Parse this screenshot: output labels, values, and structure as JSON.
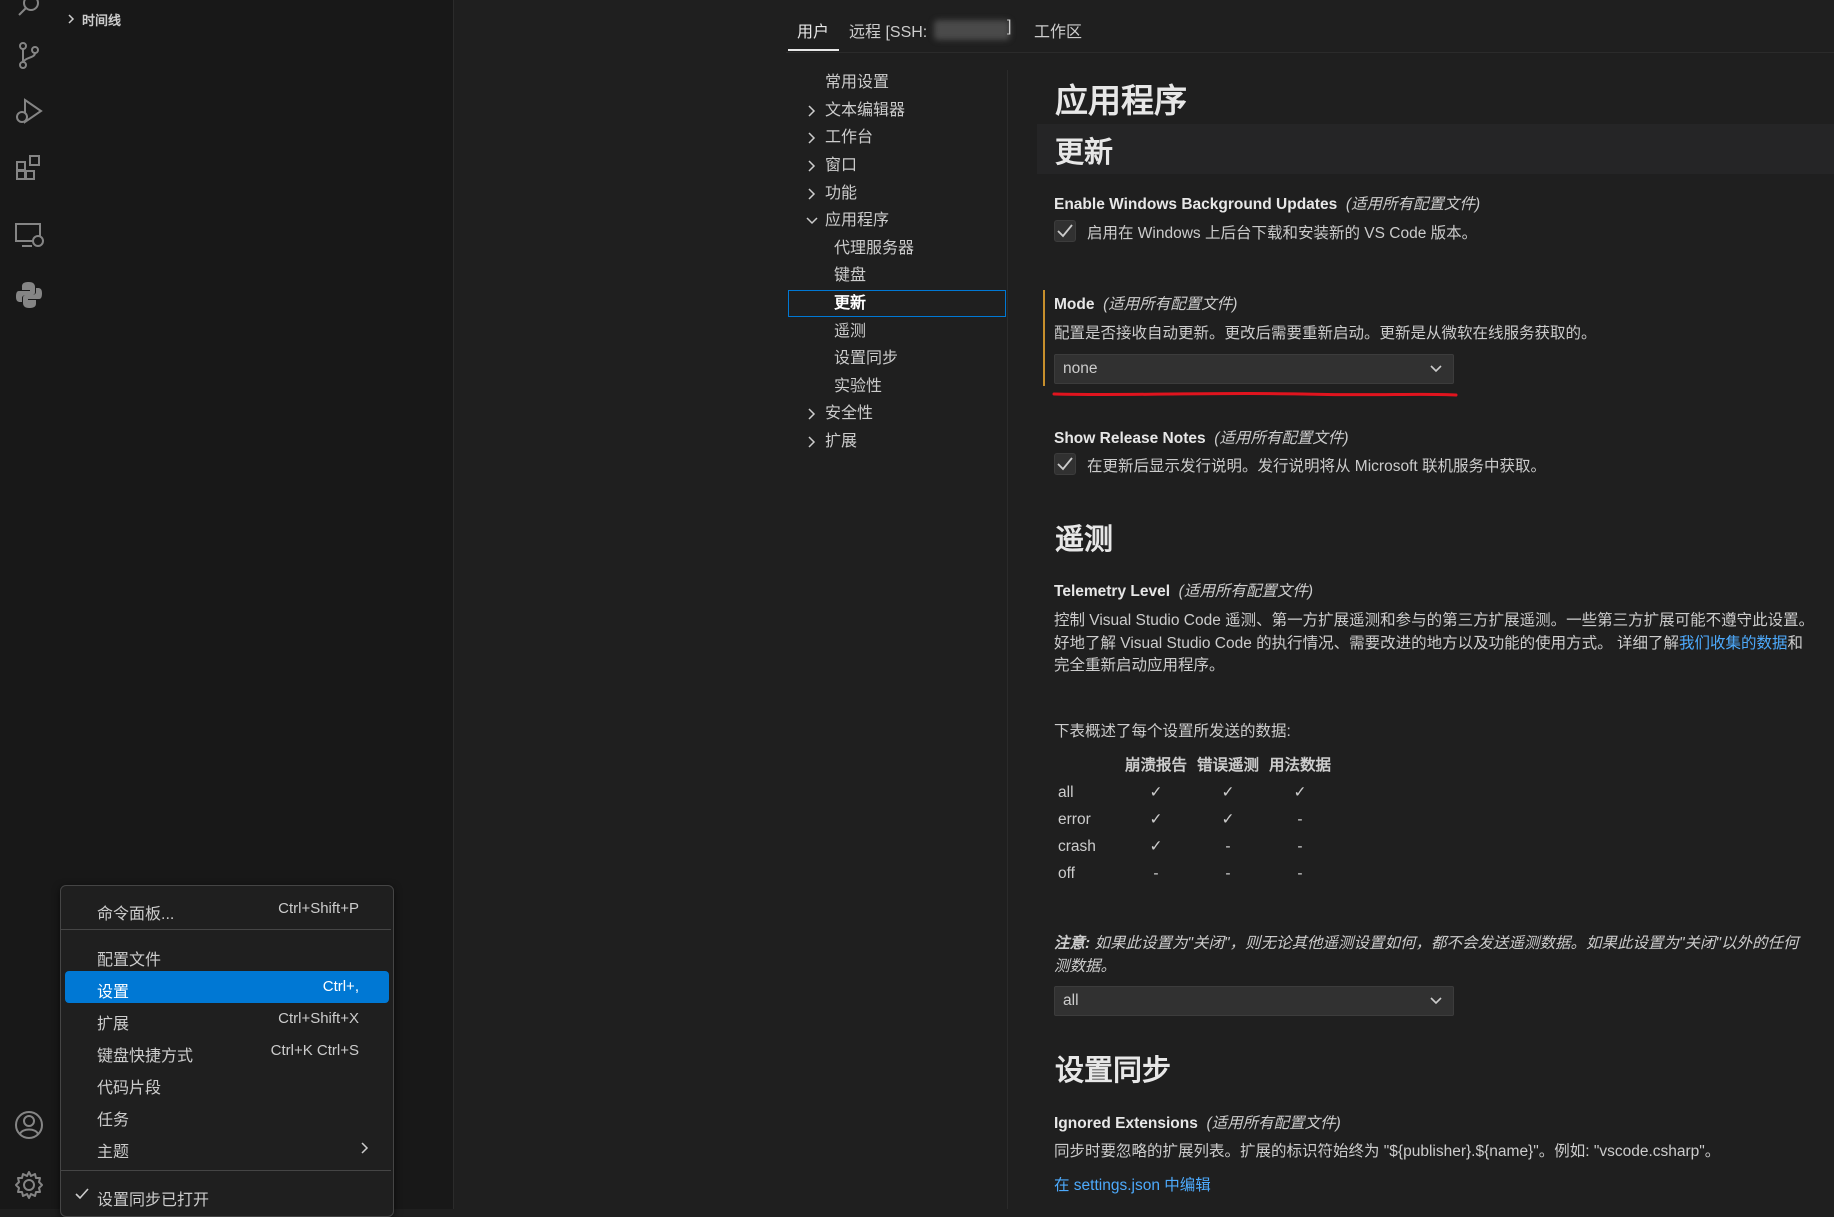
{
  "sidebar": {
    "timeline_label": "时间线"
  },
  "menu": {
    "items": [
      {
        "label": "命令面板...",
        "key": "Ctrl+Shift+P"
      },
      {
        "label": "配置文件",
        "key": ""
      },
      {
        "label": "设置",
        "key": "Ctrl+,"
      },
      {
        "label": "扩展",
        "key": "Ctrl+Shift+X"
      },
      {
        "label": "键盘快捷方式",
        "key": "Ctrl+K Ctrl+S"
      },
      {
        "label": "代码片段",
        "key": ""
      },
      {
        "label": "任务",
        "key": ""
      },
      {
        "label": "主题",
        "key": ""
      },
      {
        "label": "设置同步已打开",
        "key": ""
      }
    ]
  },
  "settings": {
    "tabs": [
      "用户",
      "远程 [SSH:",
      "]",
      "工作区"
    ],
    "toc": {
      "items": [
        "常用设置",
        "文本编辑器",
        "工作台",
        "窗口",
        "功能",
        "应用程序",
        "代理服务器",
        "键盘",
        "更新",
        "遥测",
        "设置同步",
        "实验性",
        "安全性",
        "扩展"
      ]
    },
    "page_title": "应用程序",
    "scope_label": "(适用所有配置文件)",
    "section_update": "更新",
    "bg_updates": {
      "title": "Enable Windows Background Updates",
      "desc": "启用在 Windows 上后台下载和安装新的 VS Code 版本。",
      "checked": true
    },
    "mode": {
      "title": "Mode",
      "desc": "配置是否接收自动更新。更改后需要重新启动。更新是从微软在线服务获取的。",
      "value": "none"
    },
    "release_notes": {
      "title": "Show Release Notes",
      "desc": "在更新后显示发行说明。发行说明将从 Microsoft 联机服务中获取。",
      "checked": true
    },
    "section_telemetry": "遥测",
    "telemetry": {
      "title": "Telemetry Level",
      "desc_line1": "控制 Visual Studio Code 遥测、第一方扩展遥测和参与的第三方扩展遥测。一些第三方扩展可能不遵守此设置。",
      "desc_line2_prefix": "好地了解 Visual Studio Code 的执行情况、需要改进的地方以及功能的使用方式。 详细了解",
      "desc_line2_link": "我们收集的数据",
      "desc_line2_suffix": "和",
      "desc_line3": "完全重新启动应用程序。",
      "table_intro": "下表概述了每个设置所发送的数据:",
      "table_headers": [
        "崩溃报告",
        "错误遥测",
        "用法数据"
      ],
      "table_rows": [
        {
          "level": "all",
          "cells": [
            "✓",
            "✓",
            "✓"
          ]
        },
        {
          "level": "error",
          "cells": [
            "✓",
            "✓",
            "-"
          ]
        },
        {
          "level": "crash",
          "cells": [
            "✓",
            "-",
            "-"
          ]
        },
        {
          "level": "off",
          "cells": [
            "-",
            "-",
            "-"
          ]
        }
      ],
      "note_label": "注意:",
      "note_line1": " 如果此设置为\"关闭\"，则无论其他遥测设置如何，都不会发送遥测数据。如果此设置为\"关闭\"以外的任何",
      "note_line2": "测数据。",
      "value": "all"
    },
    "section_sync": "设置同步",
    "ignored_ext": {
      "title": "Ignored Extensions",
      "desc": "同步时要忽略的扩展列表。扩展的标识符始终为 \"${publisher}.${name}\"。例如: \"vscode.csharp\"。",
      "link": "在 settings.json 中编辑"
    }
  }
}
